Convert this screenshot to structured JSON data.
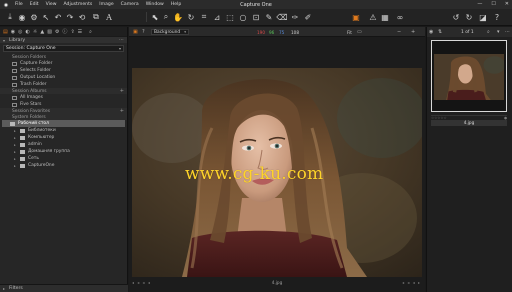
{
  "app": {
    "title": "Capture One",
    "menu": [
      "File",
      "Edit",
      "View",
      "Adjustments",
      "Image",
      "Camera",
      "Window",
      "Help"
    ],
    "window_controls": [
      "—",
      "☐",
      "✕"
    ]
  },
  "colors": {
    "accent": "#e07a1d",
    "watermark": "#ffd42a",
    "hist_red": "#d84a4a",
    "hist_green": "#59c35a",
    "hist_blue": "#5a8fe0"
  },
  "left_panel": {
    "tabs": [
      "folder-icon",
      "camera-icon",
      "lens-icon",
      "palette-icon",
      "exposure-icon",
      "detail-icon",
      "local-adjust-icon",
      "adjustments-icon",
      "metadata-icon",
      "output-icon",
      "batch-icon"
    ],
    "library_label": "Library",
    "session_value": "Session: Capture One",
    "session_folders_label": "Session Folders",
    "session_folders": [
      "Capture Folder",
      "Selects Folder",
      "Output Location",
      "Trash Folder"
    ],
    "session_albums_label": "Session Albums",
    "session_albums": [
      "All Images",
      "Five Stars"
    ],
    "session_favorites_label": "Session Favorites",
    "system_folders_label": "System Folders",
    "folders": [
      {
        "label": "Рабочий стол",
        "selected": true,
        "indent": 0
      },
      {
        "label": "Библиотеки",
        "selected": false,
        "indent": 1
      },
      {
        "label": "Компьютер",
        "selected": false,
        "indent": 1
      },
      {
        "label": "admin",
        "selected": false,
        "indent": 1
      },
      {
        "label": "Домашняя группа",
        "selected": false,
        "indent": 1
      },
      {
        "label": "Сеть",
        "selected": false,
        "indent": 1
      },
      {
        "label": "CaptureOne",
        "selected": false,
        "indent": 1
      }
    ],
    "filters_label": "Filters"
  },
  "viewer": {
    "background_label": "Background",
    "hist_r": "190",
    "hist_g": "96",
    "hist_b": "75",
    "hist_l": "108",
    "zoom_label": "Fit",
    "caption": "4.jpg",
    "watermark": "www.cg-ku.com"
  },
  "browser": {
    "count": "1 of 1",
    "thumb_name": "4.jpg"
  }
}
